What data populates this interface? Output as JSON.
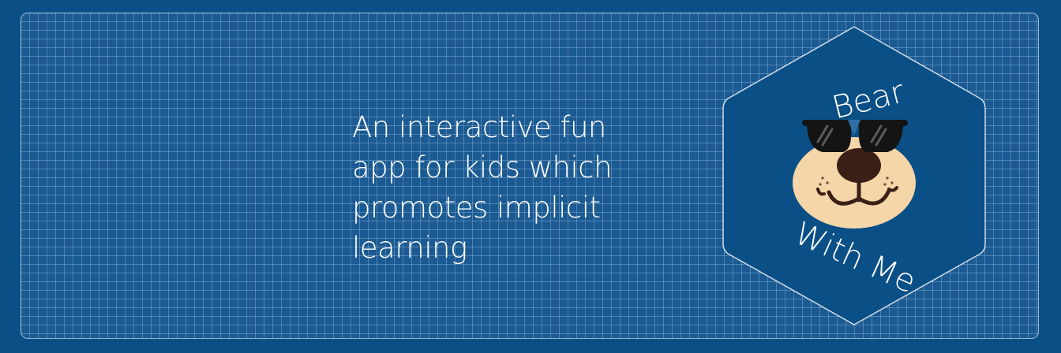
{
  "banner": {
    "tagline": "An interactive fun\napp for kids which\npromotes implicit\nlearning",
    "logo": {
      "top_text": "Bear",
      "bottom_text": "With Me"
    }
  },
  "colors": {
    "background": "#0a4f86",
    "grid_panel": "#1b5a92",
    "grid_lines": "#96b9dc",
    "text": "#ffffff",
    "bear_face": "#f5d6a8",
    "bear_nose": "#3a1f16",
    "sunglasses": "#141414"
  },
  "icons": [
    "bear-face-icon",
    "sunglasses-icon"
  ]
}
